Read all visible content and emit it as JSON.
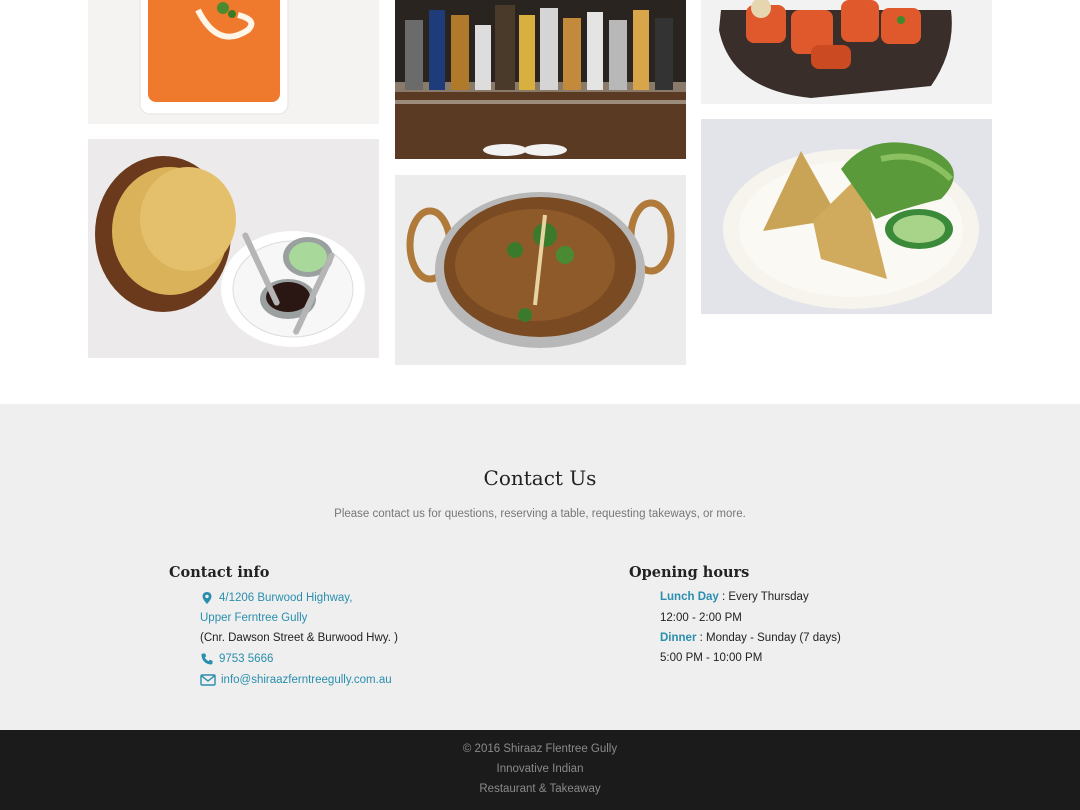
{
  "gallery": {
    "photos": [
      {
        "name": "butter-chicken-photo"
      },
      {
        "name": "bar-bottles-photo"
      },
      {
        "name": "tandoori-platter-photo"
      },
      {
        "name": "papadums-chutney-photo"
      },
      {
        "name": "curry-karahi-photo"
      },
      {
        "name": "samosa-salad-photo"
      }
    ]
  },
  "contact": {
    "title": "Contact Us",
    "subtitle": "Please contact us for questions, reserving a table, requesting takeways, or more.",
    "info": {
      "heading": "Contact info",
      "address_line1": "4/1206 Burwood Highway,",
      "address_line2": "Upper Ferntree Gully",
      "address_note": "(Cnr. Dawson Street & Burwood Hwy. )",
      "phone": "9753 5666",
      "email": "info@shiraazferntreegully.com.au",
      "icons": [
        "map-marker-icon",
        "phone-icon",
        "envelope-icon"
      ]
    },
    "hours": {
      "heading": "Opening hours",
      "lunch_label": "Lunch Day",
      "lunch_days": " : Every Thursday",
      "lunch_time": "12:00 - 2:00 PM",
      "dinner_label": "Dinner",
      "dinner_days": " : Monday - Sunday (7 days)",
      "dinner_time": "5:00 PM - 10:00 PM"
    }
  },
  "footer": {
    "copyright": "© 2016 Shiraaz Flentree Gully",
    "tagline": "Innovative Indian",
    "type": "Restaurant & Takeaway"
  },
  "colors": {
    "link": "#2a8eae",
    "contact_bg": "#efefef",
    "footer_bg": "#1b1b1b"
  }
}
